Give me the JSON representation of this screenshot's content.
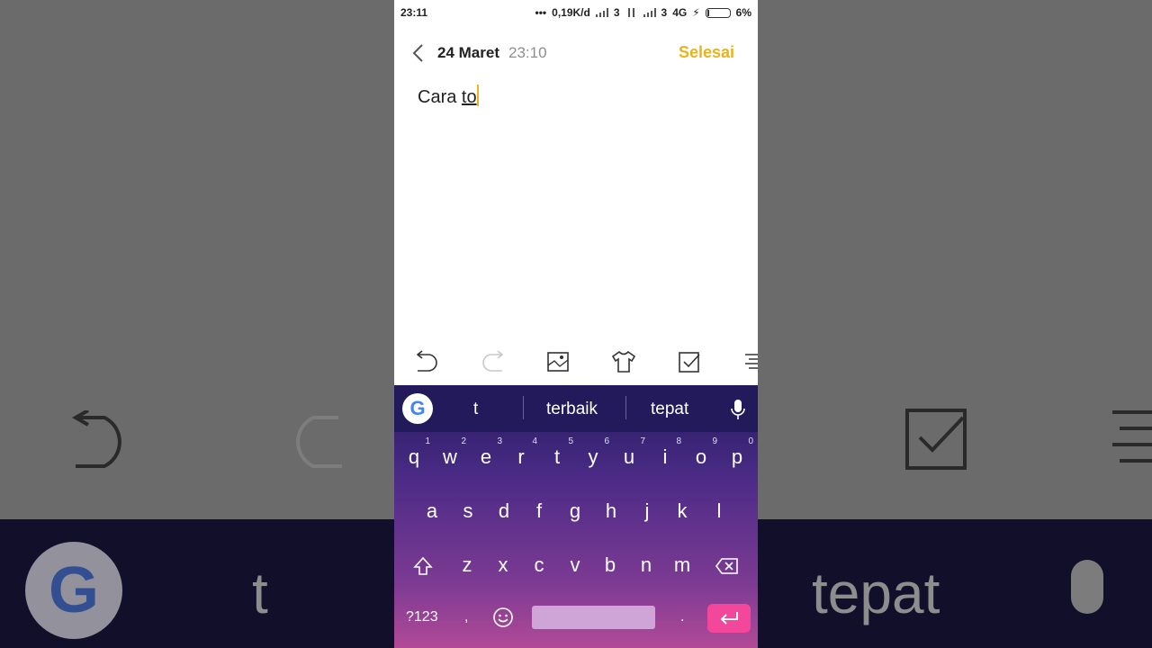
{
  "status_bar": {
    "time": "23:11",
    "network_speed": "0,19K/d",
    "sim1": "3",
    "sim2": "3",
    "network_type": "4G",
    "battery": "6%"
  },
  "header": {
    "date": "24 Maret",
    "time": "23:10",
    "done_label": "Selesai"
  },
  "note": {
    "text_plain": "Cara ",
    "text_composing": "to"
  },
  "toolbar": {
    "icons": [
      "undo-icon",
      "redo-icon",
      "image-icon",
      "theme-icon",
      "checklist-icon",
      "format-icon"
    ]
  },
  "keyboard": {
    "suggestions": [
      "t",
      "terbaik",
      "tepat"
    ],
    "row1": [
      {
        "key": "q",
        "hint": "1"
      },
      {
        "key": "w",
        "hint": "2"
      },
      {
        "key": "e",
        "hint": "3"
      },
      {
        "key": "r",
        "hint": "4"
      },
      {
        "key": "t",
        "hint": "5"
      },
      {
        "key": "y",
        "hint": "6"
      },
      {
        "key": "u",
        "hint": "7"
      },
      {
        "key": "i",
        "hint": "8"
      },
      {
        "key": "o",
        "hint": "9"
      },
      {
        "key": "p",
        "hint": "0"
      }
    ],
    "row2": [
      "a",
      "s",
      "d",
      "f",
      "g",
      "h",
      "j",
      "k",
      "l"
    ],
    "row3": [
      "z",
      "x",
      "c",
      "v",
      "b",
      "n",
      "m"
    ],
    "symbols_label": "?123",
    "comma": ",",
    "period": "."
  },
  "background": {
    "suggestion_left": "t",
    "suggestion_right": "tepat"
  },
  "colors": {
    "accent": "#e8b31c",
    "enter_key": "#f2479b",
    "keyboard_top": "#241b5e",
    "keyboard_bottom": "#b14a96"
  }
}
